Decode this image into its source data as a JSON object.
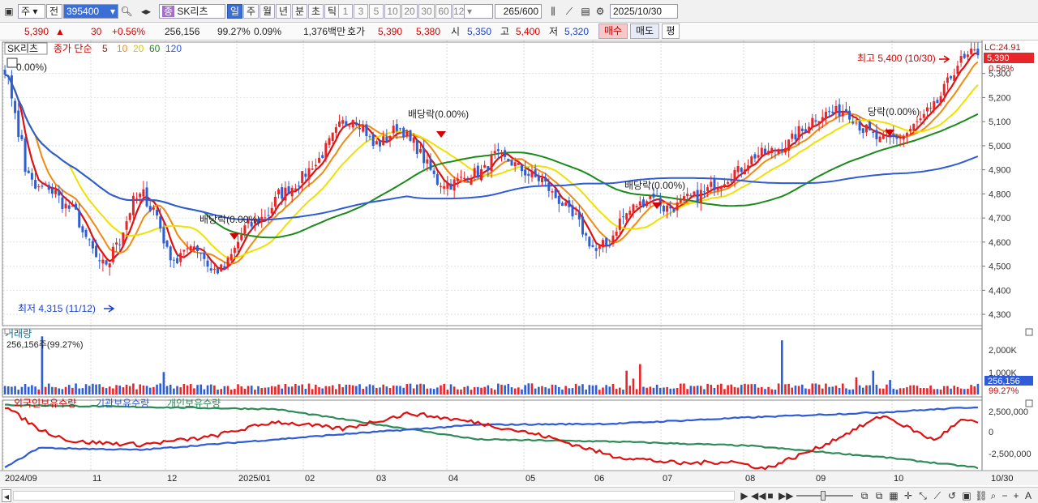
{
  "toolbar": {
    "market_label": "주",
    "type_label": "전",
    "code": "395400",
    "name": "SK리츠",
    "periods": [
      "일",
      "주",
      "월",
      "년",
      "분",
      "초",
      "틱"
    ],
    "active_period": "일",
    "ticks": [
      "1",
      "3",
      "5",
      "10",
      "20",
      "30",
      "60",
      "120"
    ],
    "count": "265",
    "count_max": "/600",
    "date": "2025/10/30"
  },
  "quote": {
    "price": "5,390",
    "arrow": "▲",
    "change": "30",
    "change_pct": "+0.56%",
    "volume": "256,156",
    "vol_ratio": "99.27%",
    "turnover": "0.09%",
    "amount": "1,376백만",
    "bid_label": "호가",
    "ask": "5,390",
    "bid": "5,380",
    "open_label": "시",
    "open": "5,350",
    "high_label": "고",
    "high": "5,400",
    "low_label": "저",
    "low": "5,320",
    "buy_label": "매수",
    "sell_label": "매도",
    "eval_label": "평"
  },
  "legend": {
    "name": "SK리츠",
    "label": "종가 단순",
    "ma_periods": [
      "5",
      "10",
      "20",
      "60",
      "120"
    ]
  },
  "price_axis": {
    "lc": "LC:24.91",
    "current_price": "5,390",
    "current_pct": "0.56%",
    "ticks": [
      "5,300",
      "5,200",
      "5,100",
      "5,000",
      "4,900",
      "4,800",
      "4,700",
      "4,600",
      "4,500",
      "4,400",
      "4,300"
    ]
  },
  "annotations": {
    "top_pct": "0.00%)",
    "high_label": "최고 5,400 (10/30)",
    "low_label": "최저 4,315 (11/12)",
    "dividend": "배당락(0.00%)",
    "dividend_2": "배당락(0.00%)",
    "dividend_3": "배당락(0.00%)",
    "dividend_4": "배당락(0.00%)",
    "dividend_5": "당락(0.00%)"
  },
  "volume_panel": {
    "title": "거래량",
    "info": "256,156주(99.27%)",
    "ticks": [
      "2,000K",
      "1,000K"
    ],
    "current": "256,156",
    "current_pct": "99.27%"
  },
  "holder_panel": {
    "legend": [
      "외국인보유수량",
      "기관보유수량",
      "개인보유수량"
    ],
    "ticks": [
      "2,500,000",
      "0",
      "-2,500,000"
    ]
  },
  "date_axis": [
    "2024/09",
    "11",
    "12",
    "2025/01",
    "02",
    "03",
    "04",
    "05",
    "06",
    "07",
    "08",
    "09",
    "10"
  ],
  "date_axis_end": "10/30",
  "statusbar": {
    "zoom_buttons": [
      "−",
      "+",
      "A"
    ]
  },
  "colors": {
    "up": "#e8262a",
    "down": "#2e5ed6",
    "ma5": "#e01010",
    "ma10": "#f08a10",
    "ma20": "#f0e000",
    "ma60": "#1a8a1a",
    "ma120": "#2f5bd8",
    "foreign": "#e01010",
    "institution": "#2f5bd8",
    "retail": "#2e8b57"
  },
  "chart_data": {
    "type": "candlestick",
    "title": "SK리츠",
    "price_range": [
      4260,
      5430
    ],
    "volume_range": [
      0,
      2300000
    ],
    "holder_range": [
      -3400000,
      3100000
    ],
    "ma_periods": [
      5,
      10,
      20,
      60,
      120
    ],
    "price_anchors": [
      [
        0,
        5320
      ],
      [
        3,
        5150
      ],
      [
        5,
        4900
      ],
      [
        8,
        4820
      ],
      [
        12,
        4830
      ],
      [
        15,
        4760
      ],
      [
        19,
        4720
      ],
      [
        22,
        4600
      ],
      [
        25,
        4500
      ],
      [
        28,
        4520
      ],
      [
        31,
        4650
      ],
      [
        34,
        4770
      ],
      [
        37,
        4800
      ],
      [
        40,
        4710
      ],
      [
        43,
        4560
      ],
      [
        46,
        4520
      ],
      [
        49,
        4600
      ],
      [
        52,
        4560
      ],
      [
        55,
        4480
      ],
      [
        58,
        4490
      ],
      [
        61,
        4570
      ],
      [
        64,
        4660
      ],
      [
        67,
        4690
      ],
      [
        70,
        4720
      ],
      [
        73,
        4800
      ],
      [
        77,
        4840
      ],
      [
        81,
        4900
      ],
      [
        85,
        4990
      ],
      [
        89,
        5080
      ],
      [
        92,
        5120
      ],
      [
        95,
        5080
      ],
      [
        98,
        5000
      ],
      [
        101,
        5030
      ],
      [
        104,
        5080
      ],
      [
        106,
        5060
      ],
      [
        109,
        4990
      ],
      [
        112,
        4920
      ],
      [
        115,
        4850
      ],
      [
        118,
        4840
      ],
      [
        121,
        4860
      ],
      [
        124,
        4880
      ],
      [
        127,
        4900
      ],
      [
        130,
        4960
      ],
      [
        133,
        4940
      ],
      [
        136,
        4910
      ],
      [
        139,
        4880
      ],
      [
        142,
        4860
      ],
      [
        145,
        4800
      ],
      [
        148,
        4760
      ],
      [
        151,
        4700
      ],
      [
        154,
        4620
      ],
      [
        157,
        4560
      ],
      [
        160,
        4600
      ],
      [
        163,
        4690
      ],
      [
        166,
        4730
      ],
      [
        169,
        4770
      ],
      [
        172,
        4800
      ],
      [
        175,
        4740
      ],
      [
        178,
        4750
      ],
      [
        181,
        4780
      ],
      [
        184,
        4790
      ],
      [
        187,
        4830
      ],
      [
        190,
        4850
      ],
      [
        193,
        4880
      ],
      [
        196,
        4920
      ],
      [
        199,
        4960
      ],
      [
        202,
        4970
      ],
      [
        205,
        4990
      ],
      [
        208,
        5010
      ],
      [
        211,
        5060
      ],
      [
        214,
        5110
      ],
      [
        217,
        5130
      ],
      [
        220,
        5140
      ],
      [
        223,
        5150
      ],
      [
        226,
        5100
      ],
      [
        229,
        5050
      ],
      [
        232,
        5020
      ],
      [
        235,
        5030
      ],
      [
        238,
        5040
      ],
      [
        241,
        5080
      ],
      [
        244,
        5120
      ],
      [
        247,
        5180
      ],
      [
        250,
        5260
      ],
      [
        253,
        5340
      ],
      [
        256,
        5380
      ],
      [
        258,
        5390
      ]
    ],
    "volume_series": {
      "base": 300000,
      "spikes": [
        [
          11,
          2200000
        ],
        [
          47,
          850000
        ],
        [
          184,
          900000
        ],
        [
          186,
          600000
        ],
        [
          188,
          1150000
        ],
        [
          230,
          2050000
        ],
        [
          257,
          900000
        ],
        [
          252,
          650000
        ],
        [
          262,
          550000
        ]
      ]
    },
    "holders": {
      "foreign": [
        [
          0,
          2650000
        ],
        [
          10,
          500000
        ],
        [
          20,
          -700000
        ],
        [
          40,
          -1000000
        ],
        [
          60,
          -300000
        ],
        [
          80,
          1200000
        ],
        [
          100,
          500000
        ],
        [
          120,
          2000000
        ],
        [
          140,
          1100000
        ],
        [
          160,
          -200000
        ],
        [
          180,
          -2100000
        ],
        [
          200,
          -2800000
        ],
        [
          215,
          -2600000
        ],
        [
          225,
          -3300000
        ],
        [
          240,
          -1400000
        ],
        [
          260,
          1800000
        ],
        [
          275,
          -600000
        ],
        [
          283,
          1300000
        ],
        [
          288,
          1100000
        ]
      ],
      "institution": [
        [
          0,
          -3200000
        ],
        [
          10,
          -1300000
        ],
        [
          40,
          -1500000
        ],
        [
          100,
          0
        ],
        [
          140,
          900000
        ],
        [
          180,
          1000000
        ],
        [
          220,
          1600000
        ],
        [
          260,
          2100000
        ],
        [
          288,
          2600000
        ]
      ],
      "retail": [
        [
          0,
          2800000
        ],
        [
          80,
          2400000
        ],
        [
          140,
          -500000
        ],
        [
          180,
          -700000
        ],
        [
          220,
          -1100000
        ],
        [
          260,
          -2200000
        ],
        [
          288,
          -3200000
        ]
      ]
    }
  }
}
